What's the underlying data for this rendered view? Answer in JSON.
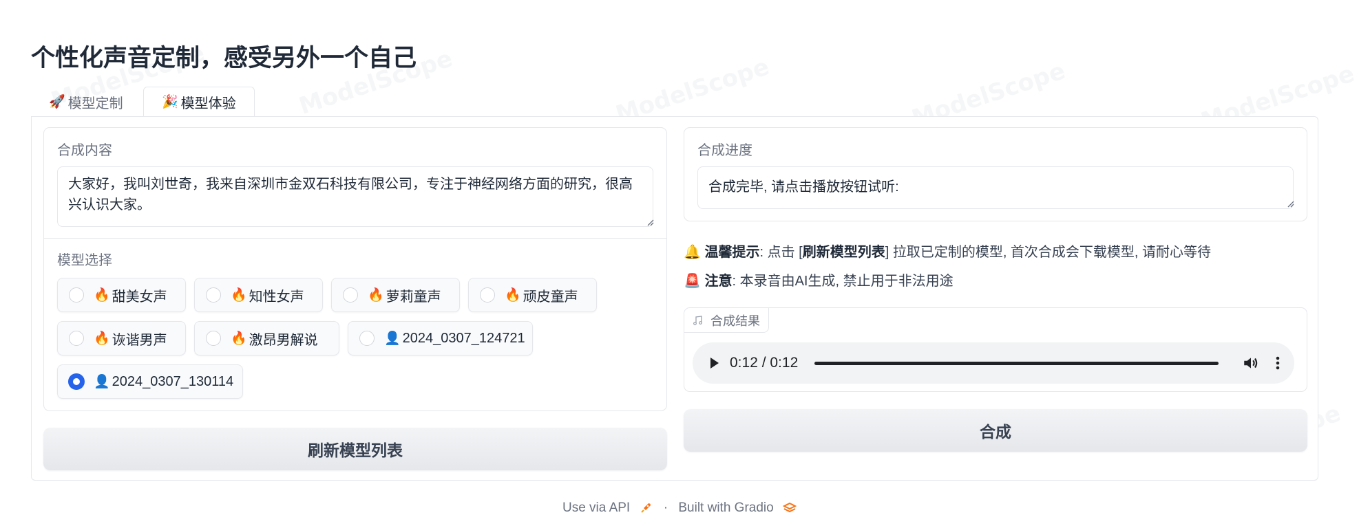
{
  "page": {
    "title": "个性化声音定制，感受另外一个自己"
  },
  "tabs": [
    {
      "emoji": "🚀",
      "label": "模型定制"
    },
    {
      "emoji": "🎉",
      "label": "模型体验"
    }
  ],
  "synth_content": {
    "label": "合成内容",
    "text": "大家好，我叫刘世奇，我来自深圳市金双石科技有限公司，专注于神经网络方面的研究，很高兴认识大家。"
  },
  "model_select": {
    "label": "模型选择",
    "options": [
      {
        "emoji": "🔥",
        "label": "甜美女声"
      },
      {
        "emoji": "🔥",
        "label": "知性女声"
      },
      {
        "emoji": "🔥",
        "label": "萝莉童声"
      },
      {
        "emoji": "🔥",
        "label": "顽皮童声"
      },
      {
        "emoji": "🔥",
        "label": "诙谐男声"
      },
      {
        "emoji": "🔥",
        "label": "激昂男解说"
      },
      {
        "emoji": "👤",
        "label": "2024_0307_124721"
      },
      {
        "emoji": "👤",
        "label": "2024_0307_130114"
      }
    ],
    "selected_label": "2024_0307_130114"
  },
  "refresh_button": {
    "label": "刷新模型列表"
  },
  "progress": {
    "label": "合成进度",
    "text": "合成完毕, 请点击播放按钮试听:"
  },
  "tips": {
    "tip1_emoji": "🔔",
    "tip1_title": "温馨提示",
    "tip1_pre": ": 点击 [",
    "tip1_bold": "刷新模型列表",
    "tip1_post": "] 拉取已定制的模型, 首次合成会下载模型, 请耐心等待",
    "tip2_emoji": "🚨",
    "tip2_title": "注意",
    "tip2_text": ": 本录音由AI生成, 禁止用于非法用途"
  },
  "result": {
    "label": "合成结果",
    "time": "0:12 / 0:12"
  },
  "synth_button": {
    "label": "合成"
  },
  "footer": {
    "api_text": "Use via API",
    "separator": "·",
    "built_text": "Built with Gradio"
  },
  "watermark": "ModelScope",
  "colors": {
    "accent": "#2563eb",
    "button_bg": "#e5e7eb",
    "border": "#e5e7eb"
  }
}
